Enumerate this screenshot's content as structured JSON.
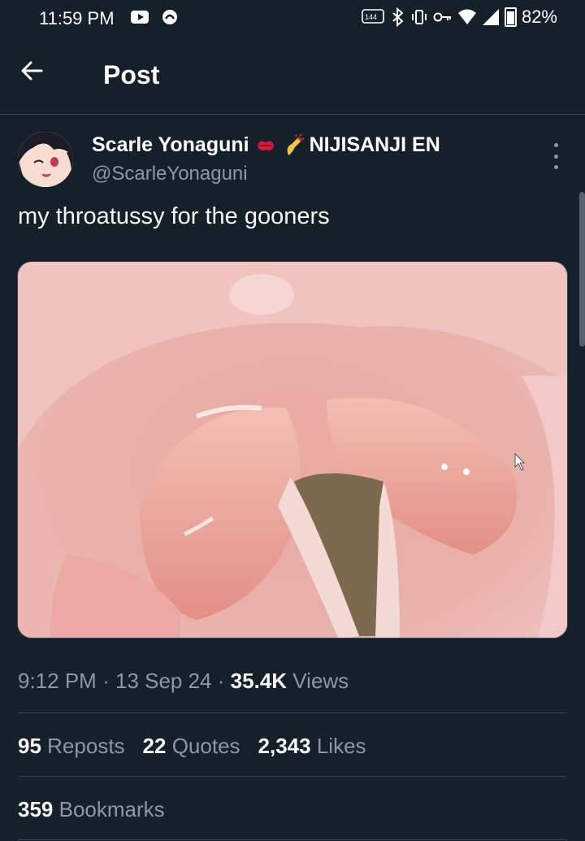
{
  "status_bar": {
    "time": "11:59 PM",
    "refresh_rate": "144",
    "battery": "82%"
  },
  "header": {
    "title": "Post"
  },
  "post": {
    "display_name": "Scarle Yonaguni",
    "affiliation": "NIJISANJI EN",
    "handle": "@ScarleYonaguni",
    "text": "my throatussy for the gooners",
    "time": "9:12 PM",
    "date": "13 Sep 24",
    "views_count": "35.4K",
    "views_label": "Views",
    "reposts_count": "95",
    "reposts_label": "Reposts",
    "quotes_count": "22",
    "quotes_label": "Quotes",
    "likes_count": "2,343",
    "likes_label": "Likes",
    "bookmarks_count": "359",
    "bookmarks_label": "Bookmarks"
  },
  "colors": {
    "background": "#15202b",
    "divider": "#38444d",
    "muted": "#8b98a5",
    "text": "#ffffff"
  },
  "icons": [
    "back-arrow-icon",
    "more-icon",
    "kiss-emoji-icon",
    "nail-polish-emoji-icon",
    "bluetooth-icon",
    "vibrate-icon",
    "wifi-icon",
    "signal-icon",
    "battery-icon"
  ]
}
